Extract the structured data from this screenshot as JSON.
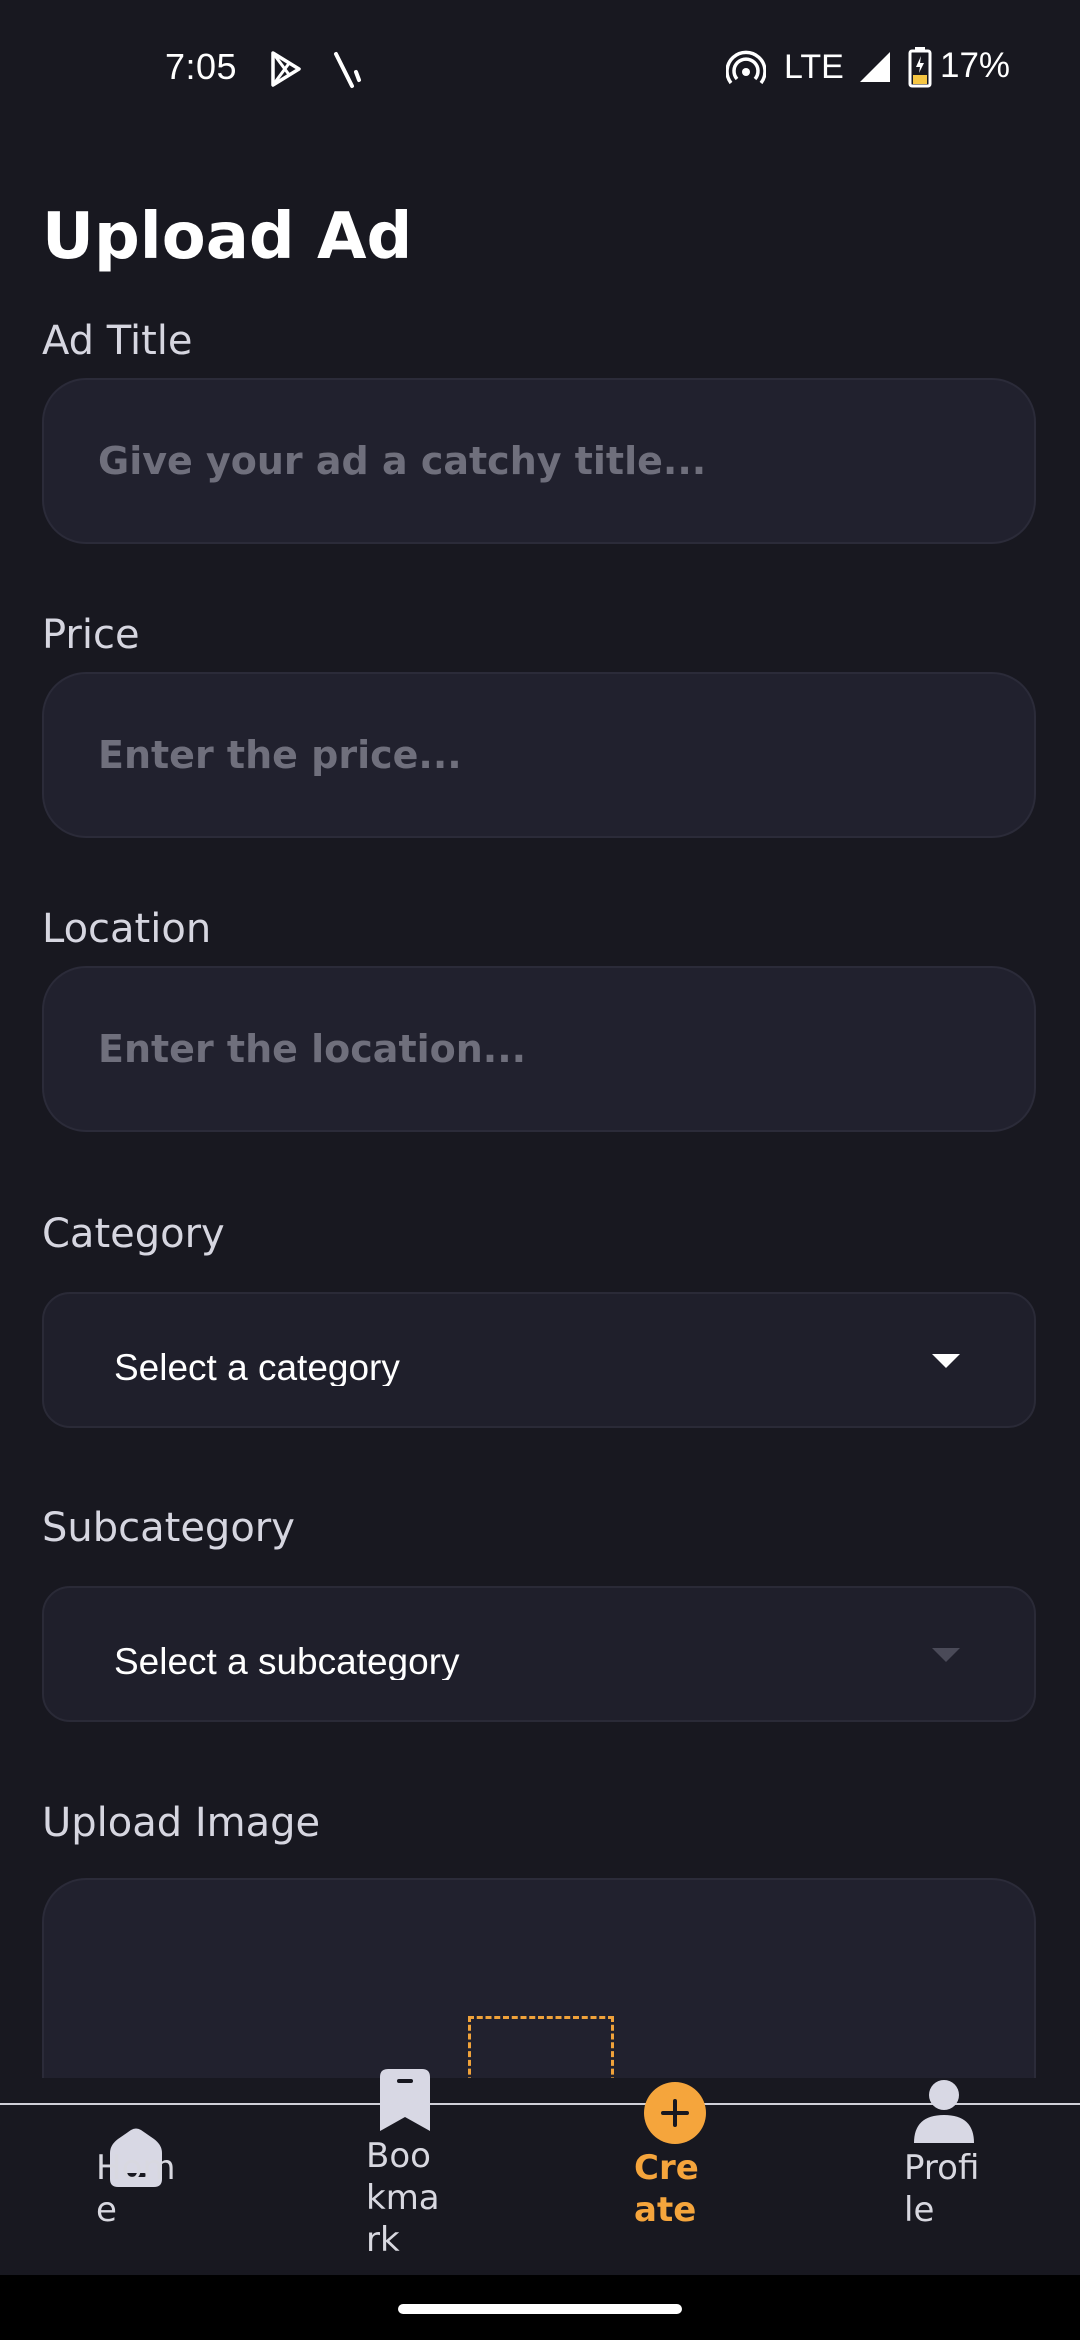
{
  "status_bar": {
    "time": "7:05",
    "network": "LTE",
    "battery": "17%"
  },
  "page": {
    "title": "Upload Ad"
  },
  "form": {
    "ad_title": {
      "label": "Ad Title",
      "placeholder": "Give your ad a catchy title...",
      "value": ""
    },
    "price": {
      "label": "Price",
      "placeholder": "Enter the price...",
      "value": ""
    },
    "location": {
      "label": "Location",
      "placeholder": "Enter the location...",
      "value": ""
    },
    "category": {
      "label": "Category",
      "selected": "Select a category"
    },
    "subcategory": {
      "label": "Subcategory",
      "selected": "Select a subcategory"
    },
    "upload_image": {
      "label": "Upload Image"
    }
  },
  "bottom_nav": {
    "items": [
      {
        "label": "Home",
        "icon": "home-icon",
        "active": false
      },
      {
        "label": "Bookmark",
        "icon": "bookmark-icon",
        "active": false
      },
      {
        "label": "Create",
        "icon": "plus-circle-icon",
        "active": true
      },
      {
        "label": "Profile",
        "icon": "person-icon",
        "active": false
      }
    ]
  },
  "colors": {
    "background": "#181820",
    "input_background": "#21212e",
    "accent": "#f5a53c",
    "text": "#ffffff",
    "label": "#d6d6e0",
    "placeholder": "#6f6f7c"
  }
}
